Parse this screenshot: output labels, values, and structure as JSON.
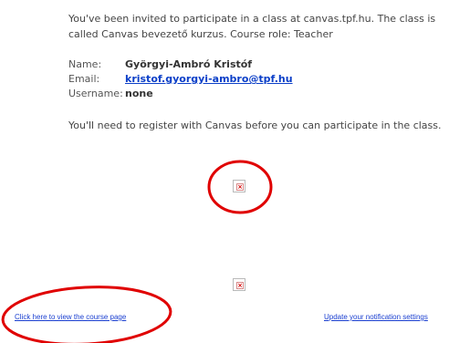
{
  "invite": {
    "line1": "You've been invited to participate in a class at canvas.tpf.hu. The class is",
    "line2": "called Canvas bevezető kurzus. Course role: Teacher"
  },
  "details": {
    "name_label": "Name:",
    "name_value": "Györgyi-Ambró Kristóf",
    "email_label": "Email:",
    "email_value": "kristof.gyorgyi-ambro@tpf.hu",
    "username_label": "Username:",
    "username_value": "none"
  },
  "notice": "You'll need to register with Canvas before you can participate in the class.",
  "footer": {
    "course_link": "Click here to view the course page",
    "notification_link": "Update your notification settings"
  },
  "annotations": {
    "color": "#e00000"
  }
}
